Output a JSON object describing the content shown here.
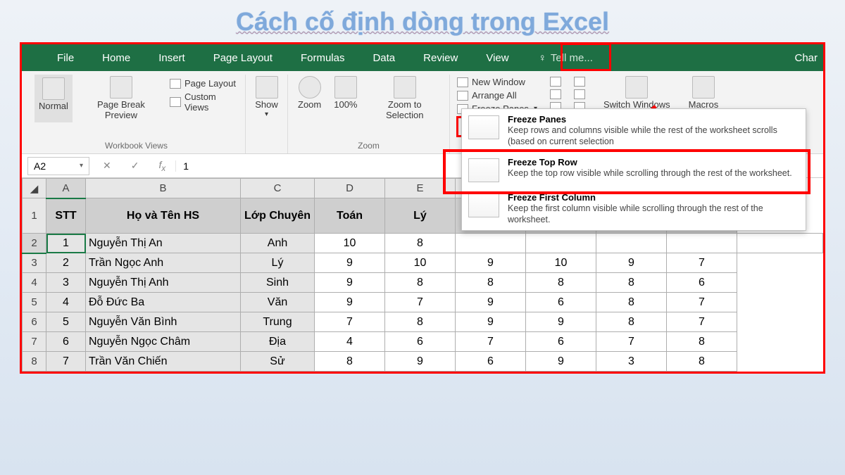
{
  "title": "Cách cố định dòng trong Excel",
  "tabs": [
    "File",
    "Home",
    "Insert",
    "Page Layout",
    "Formulas",
    "Data",
    "Review",
    "View"
  ],
  "tellme": "Tell me...",
  "right_label": "Char",
  "ribbon": {
    "views": {
      "normal": "Normal",
      "pagebreak": "Page Break Preview",
      "pagelayout": "Page Layout",
      "customviews": "Custom Views",
      "group": "Workbook Views"
    },
    "show": {
      "show": "Show",
      "arrow": "▾"
    },
    "zoom": {
      "zoom": "Zoom",
      "hundred": "100%",
      "zoomsel": "Zoom to Selection",
      "group": "Zoom"
    },
    "window": {
      "new": "New Window",
      "arrange": "Arrange All",
      "freeze": "Freeze Panes",
      "freeze_arrow": "▾",
      "switch": "Switch Windows",
      "switch_arrow": "▾",
      "macros": "Macros",
      "macros_arrow": "▾"
    }
  },
  "namebox": "A2",
  "fx_val": "1",
  "columns": [
    "A",
    "B",
    "C",
    "D",
    "E",
    "",
    "",
    "",
    "",
    ""
  ],
  "headers": [
    "STT",
    "Họ và Tên HS",
    "Lớp Chuyên",
    "Toán",
    "Lý",
    "",
    "",
    "",
    "",
    ""
  ],
  "rows": [
    {
      "n": "2",
      "stt": "1",
      "name": "Nguyễn Thị An",
      "lop": "Anh",
      "c": [
        "10",
        "8",
        "",
        "",
        "",
        "",
        ""
      ]
    },
    {
      "n": "3",
      "stt": "2",
      "name": "Trần Ngọc Anh",
      "lop": "Lý",
      "c": [
        "9",
        "10",
        "9",
        "10",
        "9",
        "7"
      ]
    },
    {
      "n": "4",
      "stt": "3",
      "name": "Nguyễn Thị Anh",
      "lop": "Sinh",
      "c": [
        "9",
        "8",
        "8",
        "8",
        "8",
        "6"
      ]
    },
    {
      "n": "5",
      "stt": "4",
      "name": "Đỗ Đức Ba",
      "lop": "Văn",
      "c": [
        "9",
        "7",
        "9",
        "6",
        "8",
        "7"
      ]
    },
    {
      "n": "6",
      "stt": "5",
      "name": "Nguyễn Văn Bình",
      "lop": "Trung",
      "c": [
        "7",
        "8",
        "9",
        "9",
        "8",
        "7"
      ]
    },
    {
      "n": "7",
      "stt": "6",
      "name": "Nguyễn Ngọc Châm",
      "lop": "Địa",
      "c": [
        "4",
        "6",
        "7",
        "6",
        "7",
        "8"
      ]
    },
    {
      "n": "8",
      "stt": "7",
      "name": "Trần Văn Chiến",
      "lop": "Sử",
      "c": [
        "8",
        "9",
        "6",
        "9",
        "3",
        "8"
      ]
    }
  ],
  "dropdown": {
    "fp": {
      "t": "Freeze Panes",
      "d": "Keep rows and columns visible while the rest of the worksheet scrolls (based on current selection"
    },
    "ftr": {
      "t": "Freeze Top Row",
      "d": "Keep the top row visible while scrolling through the rest of the worksheet."
    },
    "ffc": {
      "t": "Freeze First Column",
      "d": "Keep the first column visible while scrolling through the rest of the worksheet."
    }
  }
}
